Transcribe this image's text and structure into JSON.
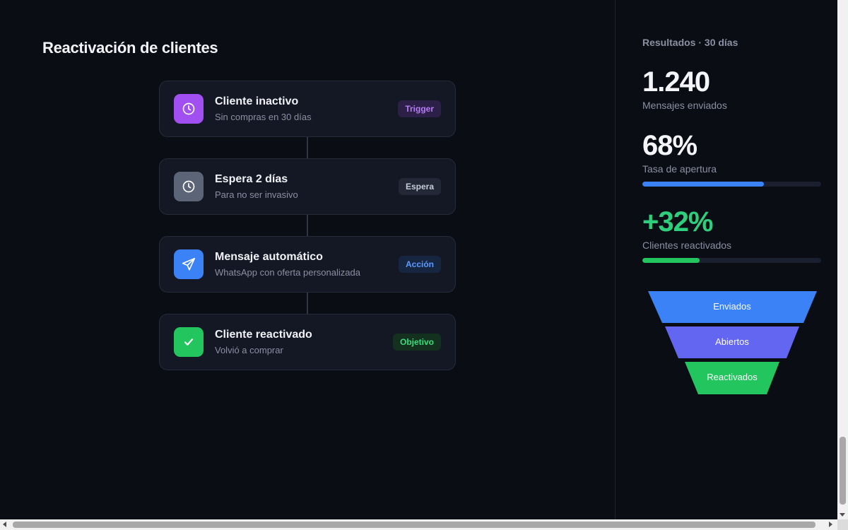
{
  "main": {
    "title": "Reactivación de clientes",
    "steps": [
      {
        "title": "Cliente inactivo",
        "subtitle": "Sin compras en 30 días",
        "badge": "Trigger",
        "icon": "clock-icon",
        "icon_bg": "#a14ff0",
        "badge_bg": "#2c1f48",
        "badge_color": "#b77cf7"
      },
      {
        "title": "Espera 2 días",
        "subtitle": "Para no ser invasivo",
        "badge": "Espera",
        "icon": "clock-icon",
        "icon_bg": "#5b6577",
        "badge_bg": "#222836",
        "badge_color": "#c7ccd8"
      },
      {
        "title": "Mensaje automático",
        "subtitle": "WhatsApp con oferta personalizada",
        "badge": "Acción",
        "icon": "send-icon",
        "icon_bg": "#3b82f6",
        "badge_bg": "#172640",
        "badge_color": "#5b9bff"
      },
      {
        "title": "Cliente reactivado",
        "subtitle": "Volvió a comprar",
        "badge": "Objetivo",
        "icon": "check-icon",
        "icon_bg": "#22c55e",
        "badge_bg": "#14301f",
        "badge_color": "#3ddc7a"
      }
    ]
  },
  "side": {
    "header": "Resultados · 30 días",
    "metrics": [
      {
        "value": "1.240",
        "label": "Mensajes enviados",
        "color": "#f4f5f8"
      },
      {
        "value": "68%",
        "label": "Tasa de apertura",
        "color": "#f4f5f8",
        "progress": 0.68,
        "bar_color": "#3b82f6"
      },
      {
        "value": "+32%",
        "label": "Clientes reactivados",
        "color": "#2ecf7c",
        "progress": 0.32,
        "bar_color": "#22c55e"
      }
    ],
    "funnel": [
      {
        "label": "Enviados",
        "color": "#3b82f6"
      },
      {
        "label": "Abiertos",
        "color": "#6366f1"
      },
      {
        "label": "Reactivados",
        "color": "#22c55e"
      }
    ]
  }
}
